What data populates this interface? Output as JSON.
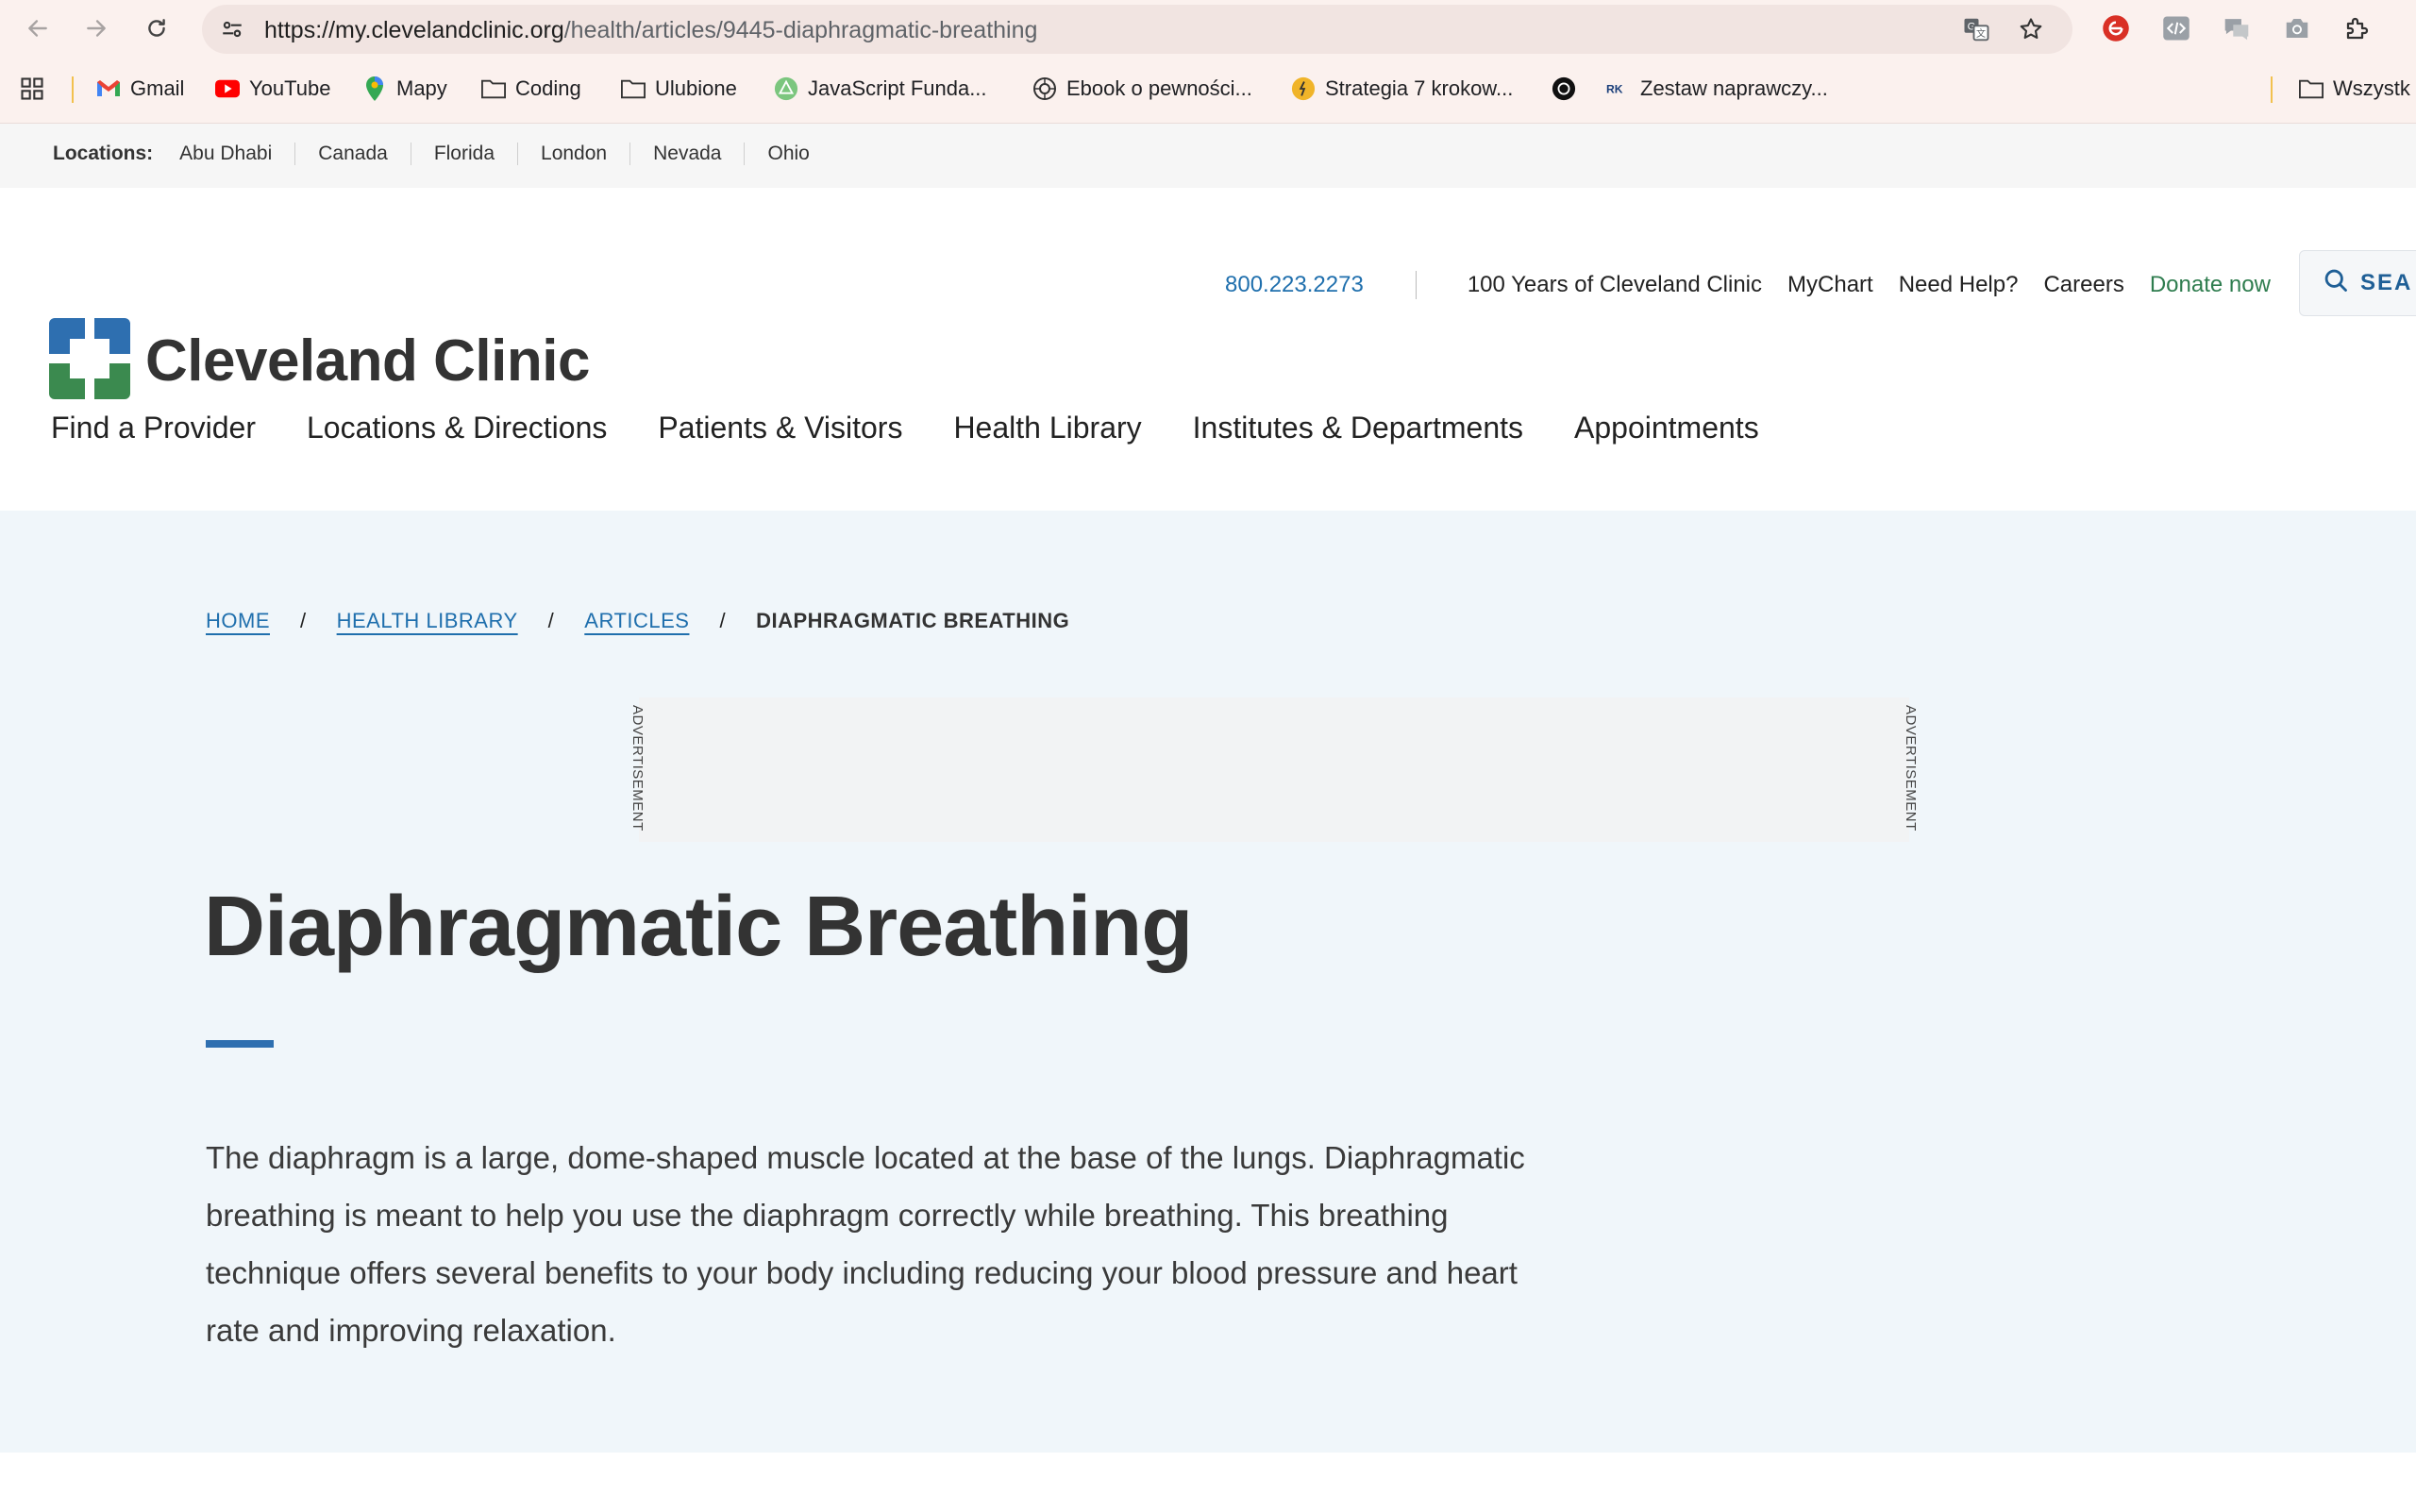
{
  "browser": {
    "url_host": "https://my.clevelandclinic.org",
    "url_path": "/health/articles/9445-diaphragmatic-breathing",
    "bookmarks": [
      {
        "label": "Gmail",
        "icon": "gmail-icon"
      },
      {
        "label": "YouTube",
        "icon": "youtube-icon"
      },
      {
        "label": "Mapy",
        "icon": "maps-pin-icon"
      },
      {
        "label": "Coding",
        "icon": "folder-icon"
      },
      {
        "label": "Ulubione",
        "icon": "folder-icon"
      },
      {
        "label": "JavaScript Funda...",
        "icon": "green-triangle-icon"
      },
      {
        "label": "Ebook o pewności...",
        "icon": "openai-icon"
      },
      {
        "label": "Strategia 7 krokow...",
        "icon": "runner-icon"
      },
      {
        "label": "",
        "icon": "openai-dark-icon"
      },
      {
        "label": "Zestaw naprawczy...",
        "icon": "rk-icon"
      },
      {
        "label": "Wszystk",
        "icon": "folder-icon"
      }
    ]
  },
  "locations": {
    "label": "Locations:",
    "items": [
      "Abu Dhabi",
      "Canada",
      "Florida",
      "London",
      "Nevada",
      "Ohio"
    ]
  },
  "header": {
    "phone": "800.223.2273",
    "links": [
      "100 Years of Cleveland Clinic",
      "MyChart",
      "Need Help?",
      "Careers"
    ],
    "donate": "Donate now",
    "search_label": "SEA",
    "logo_text": "Cleveland Clinic",
    "nav": [
      "Find a Provider",
      "Locations & Directions",
      "Patients & Visitors",
      "Health Library",
      "Institutes & Departments",
      "Appointments"
    ]
  },
  "breadcrumb": {
    "home": "HOME",
    "library": "HEALTH LIBRARY",
    "articles": "ARTICLES",
    "current": "DIAPHRAGMATIC BREATHING"
  },
  "ad": {
    "label": "ADVERTISEMENT"
  },
  "article": {
    "title": "Diaphragmatic Breathing",
    "intro": "The diaphragm is a large, dome-shaped muscle located at the base of the lungs. Diaphragmatic breathing is meant to help you use the diaphragm correctly while breathing. This breathing technique offers several benefits to your body including reducing your blood pressure and heart rate and improving relaxation."
  },
  "colors": {
    "link_blue": "#1f6fad",
    "donate_green": "#2f7d4f",
    "hero_bg": "#f0f6fa",
    "logo_blue": "#2e6fb0",
    "logo_green": "#3b8a4f"
  }
}
